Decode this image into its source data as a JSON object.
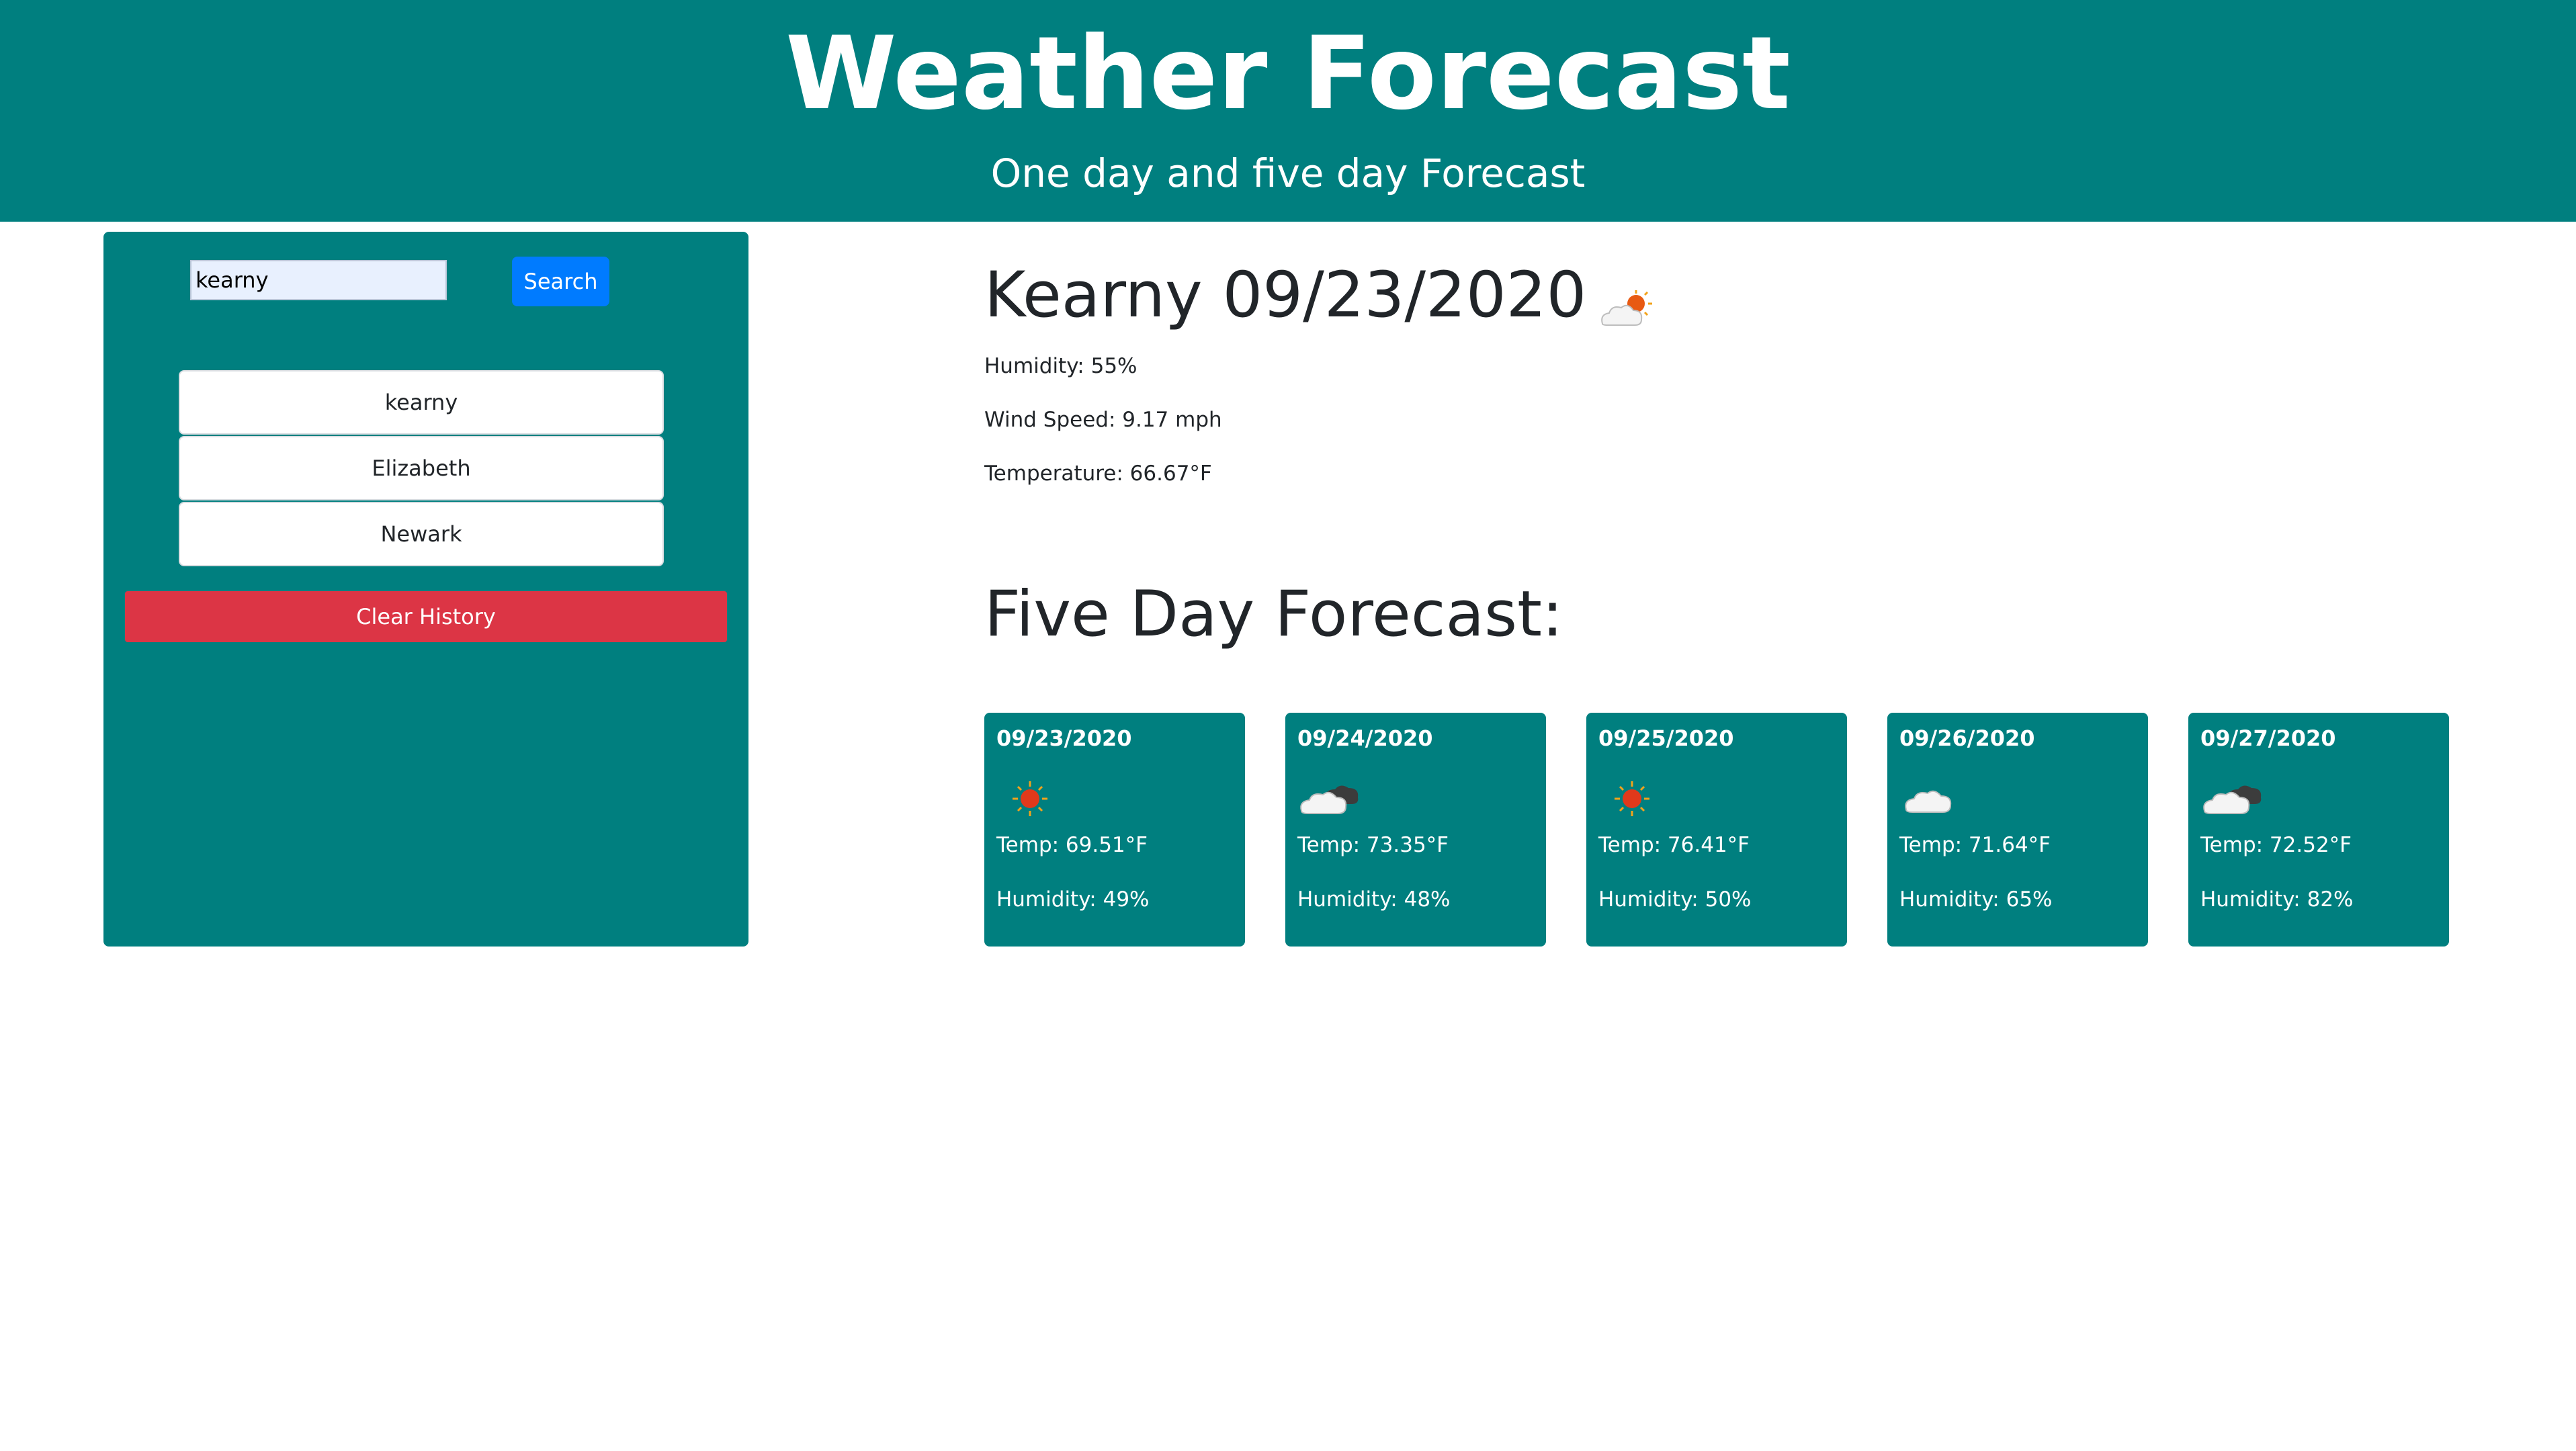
{
  "header": {
    "title": "Weather Forecast",
    "subtitle": "One day and five day Forecast"
  },
  "sidebar": {
    "search": {
      "value": "kearny",
      "button_label": "Search"
    },
    "history": [
      {
        "label": "kearny"
      },
      {
        "label": "Elizabeth"
      },
      {
        "label": "Newark"
      }
    ],
    "clear_label": "Clear History"
  },
  "current": {
    "heading": "Kearny 09/23/2020",
    "icon": "few-clouds-icon",
    "humidity": "Humidity: 55%",
    "wind": "Wind Speed: 9.17 mph",
    "temperature": "Temperature: 66.67°F"
  },
  "forecast": {
    "title": "Five Day Forecast:",
    "days": [
      {
        "date": "09/23/2020",
        "icon": "sun-icon",
        "temp": "Temp: 69.51°F",
        "humidity": "Humidity: 49%"
      },
      {
        "date": "09/24/2020",
        "icon": "broken-clouds-icon",
        "temp": "Temp: 73.35°F",
        "humidity": "Humidity: 48%"
      },
      {
        "date": "09/25/2020",
        "icon": "sun-icon",
        "temp": "Temp: 76.41°F",
        "humidity": "Humidity: 50%"
      },
      {
        "date": "09/26/2020",
        "icon": "cloud-icon",
        "temp": "Temp: 71.64°F",
        "humidity": "Humidity: 65%"
      },
      {
        "date": "09/27/2020",
        "icon": "broken-clouds-icon",
        "temp": "Temp: 72.52°F",
        "humidity": "Humidity: 82%"
      }
    ]
  },
  "colors": {
    "teal": "#007f7f",
    "search_blue": "#007bff",
    "clear_red": "#dc3545"
  }
}
